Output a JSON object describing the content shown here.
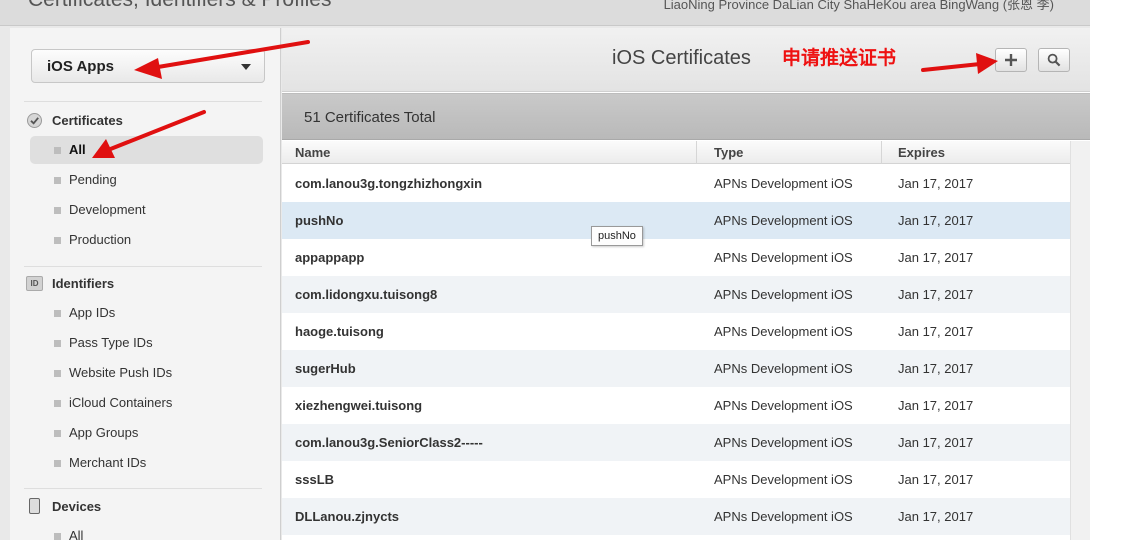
{
  "header": {
    "app_title": "Certificates, Identifiers & Profiles",
    "account": "LiaoNing Province DaLian City ShaHeKou area BingWang (张恩 李)"
  },
  "sidebar": {
    "platform": "iOS Apps",
    "sections": [
      {
        "title": "Certificates",
        "icon": "certificate-icon",
        "items": [
          {
            "label": "All",
            "selected": true
          },
          {
            "label": "Pending"
          },
          {
            "label": "Development"
          },
          {
            "label": "Production"
          }
        ]
      },
      {
        "title": "Identifiers",
        "icon": "id-badge-icon",
        "badge": "ID",
        "items": [
          {
            "label": "App IDs"
          },
          {
            "label": "Pass Type IDs"
          },
          {
            "label": "Website Push IDs"
          },
          {
            "label": "iCloud Containers"
          },
          {
            "label": "App Groups"
          },
          {
            "label": "Merchant IDs"
          }
        ]
      },
      {
        "title": "Devices",
        "icon": "device-icon",
        "items": [
          {
            "label": "All"
          }
        ]
      }
    ]
  },
  "main": {
    "title": "iOS Certificates",
    "annotation": "申请推送证书",
    "annotation_color": "#ee1111",
    "total": "51 Certificates Total",
    "columns": [
      "Name",
      "Type",
      "Expires"
    ],
    "rows": [
      {
        "name": "com.lanou3g.tongzhizhongxin",
        "type": "APNs Development iOS",
        "expires": "Jan 17, 2017"
      },
      {
        "name": "pushNo",
        "type": "APNs Development iOS",
        "expires": "Jan 17, 2017"
      },
      {
        "name": "appappapp",
        "type": "APNs Development iOS",
        "expires": "Jan 17, 2017"
      },
      {
        "name": "com.lidongxu.tuisong8",
        "type": "APNs Development iOS",
        "expires": "Jan 17, 2017"
      },
      {
        "name": "haoge.tuisong",
        "type": "APNs Development iOS",
        "expires": "Jan 17, 2017"
      },
      {
        "name": "sugerHub",
        "type": "APNs Development iOS",
        "expires": "Jan 17, 2017"
      },
      {
        "name": "xiezhengwei.tuisong",
        "type": "APNs Development iOS",
        "expires": "Jan 17, 2017"
      },
      {
        "name": "com.lanou3g.SeniorClass2-----",
        "type": "APNs Development iOS",
        "expires": "Jan 17, 2017"
      },
      {
        "name": "sssLB",
        "type": "APNs Development iOS",
        "expires": "Jan 17, 2017"
      },
      {
        "name": "DLLanou.zjnycts",
        "type": "APNs Development iOS",
        "expires": "Jan 17, 2017"
      }
    ],
    "tooltip": "pushNo"
  }
}
